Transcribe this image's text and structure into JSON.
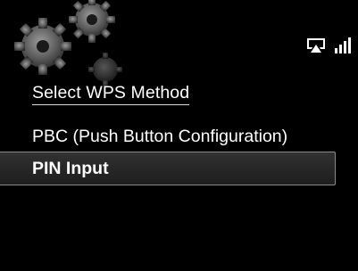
{
  "status_bar": {
    "icons": [
      "airplay-icon",
      "signal-strength-icon"
    ]
  },
  "menu": {
    "title": "Select WPS Method",
    "items": [
      {
        "label": "PBC (Push Button Configuration)",
        "selected": false
      },
      {
        "label": "PIN Input",
        "selected": true
      }
    ]
  },
  "colors": {
    "background": "#000000",
    "text": "#ffffff",
    "highlight_border": "#8a8a8a"
  }
}
